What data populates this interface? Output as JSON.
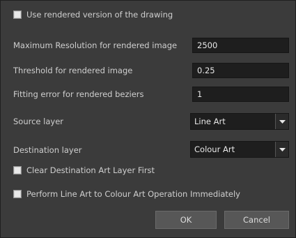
{
  "options": {
    "use_rendered": {
      "label": "Use rendered version of the drawing",
      "checked": false
    },
    "clear_destination": {
      "label": "Clear Destination Art Layer First",
      "checked": false
    },
    "perform_immediately": {
      "label": "Perform Line Art to Colour Art Operation Immediately",
      "checked": false
    }
  },
  "fields": {
    "max_resolution": {
      "label": "Maximum Resolution for rendered image",
      "value": "2500"
    },
    "threshold": {
      "label": "Threshold for rendered image",
      "value": "0.25"
    },
    "fitting_error": {
      "label": "Fitting error for rendered beziers",
      "value": "1"
    }
  },
  "layers": {
    "source": {
      "label": "Source layer",
      "value": "Line Art"
    },
    "destination": {
      "label": "Destination layer",
      "value": "Colour Art"
    }
  },
  "buttons": {
    "ok": "OK",
    "cancel": "Cancel"
  },
  "icons": {
    "dropdown": "triangle-down-icon"
  },
  "colors": {
    "dialog_bg": "#3b3b3b",
    "input_bg": "#1e1e1e",
    "text": "#cfcfcf",
    "button_bg": "#575757"
  }
}
